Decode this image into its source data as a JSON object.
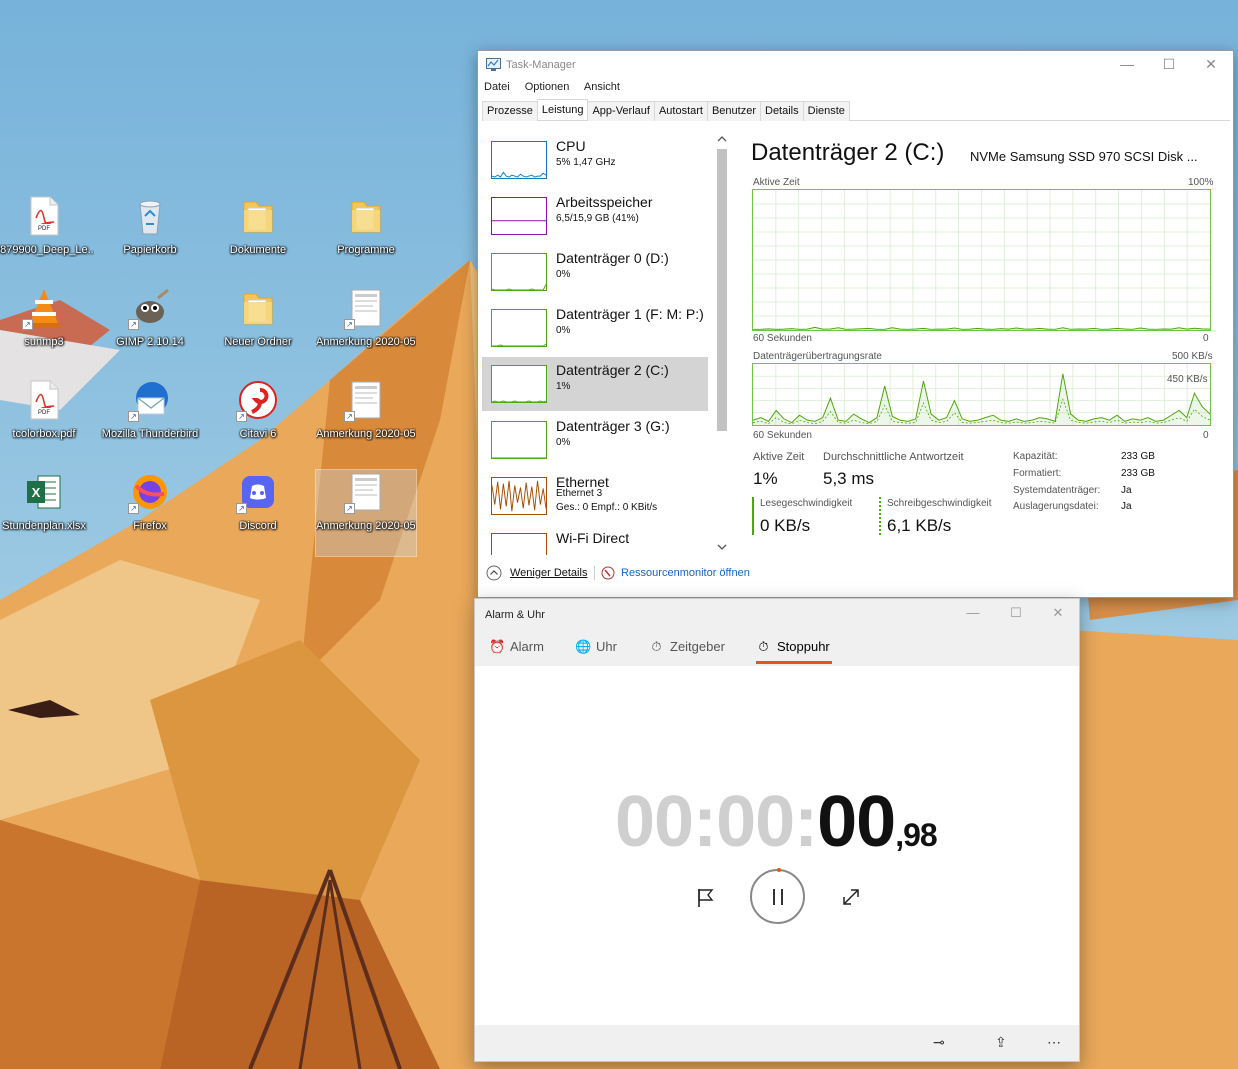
{
  "desktop": {
    "icons": [
      {
        "label": "0879900_Deep_Le...",
        "type": "pdf"
      },
      {
        "label": "Papierkorb",
        "type": "recycle"
      },
      {
        "label": "Dokumente",
        "type": "folder"
      },
      {
        "label": "Programme",
        "type": "folder"
      },
      {
        "label": "sunmp3",
        "type": "vlc"
      },
      {
        "label": "GIMP 2.10.14",
        "type": "gimp"
      },
      {
        "label": "Neuer Ordner",
        "type": "folder"
      },
      {
        "label": "Anmerkung 2020-05-0...",
        "type": "image"
      },
      {
        "label": "tcolorbox.pdf",
        "type": "pdf"
      },
      {
        "label": "Mozilla Thunderbird",
        "type": "thunderbird"
      },
      {
        "label": "Citavi 6",
        "type": "citavi"
      },
      {
        "label": "Anmerkung 2020-05-0...",
        "type": "image"
      },
      {
        "label": "Stundenplan.xlsx",
        "type": "excel"
      },
      {
        "label": "Firefox",
        "type": "firefox"
      },
      {
        "label": "Discord",
        "type": "discord"
      },
      {
        "label": "Anmerkung 2020-05-0...",
        "type": "image"
      }
    ]
  },
  "taskmgr": {
    "title": "Task-Manager",
    "menu": [
      "Datei",
      "Optionen",
      "Ansicht"
    ],
    "tabs": [
      "Prozesse",
      "Leistung",
      "App-Verlauf",
      "Autostart",
      "Benutzer",
      "Details",
      "Dienste"
    ],
    "active_tab": "Leistung",
    "window_buttons": {
      "minimize": "—",
      "maximize": "☐",
      "close": "✕"
    },
    "items": [
      {
        "name": "CPU",
        "sub": "5% 1,47 GHz",
        "color": "#117dbb"
      },
      {
        "name": "Arbeitsspeicher",
        "sub": "6,5/15,9 GB (41%)",
        "color": "#8b12ae"
      },
      {
        "name": "Datenträger 0 (D:)",
        "sub": "0%",
        "color": "#4da60c"
      },
      {
        "name": "Datenträger 1 (F: M: P:)",
        "sub": "0%",
        "color": "#4da60c"
      },
      {
        "name": "Datenträger 2 (C:)",
        "sub": "1%",
        "color": "#4da60c"
      },
      {
        "name": "Datenträger 3 (G:)",
        "sub": "0%",
        "color": "#4da60c"
      },
      {
        "name": "Ethernet",
        "sub": "Ethernet 3",
        "sub2": "Ges.: 0 Empf.: 0 KBit/s",
        "color": "#a74f01"
      },
      {
        "name": "Wi-Fi Direct",
        "sub": "",
        "color": "#a74f01"
      }
    ],
    "detail": {
      "title": "Datenträger 2 (C:)",
      "model": "NVMe Samsung SSD 970 SCSI Disk ...",
      "graph1": {
        "label": "Aktive Zeit",
        "max": "100%",
        "time": "60 Sekunden",
        "min": "0"
      },
      "graph2": {
        "label": "Datenträgerübertragungsrate",
        "max": "500 KB/s",
        "inner": "450 KB/s",
        "time": "60 Sekunden",
        "min": "0"
      },
      "stats": {
        "active_label": "Aktive Zeit",
        "active_value": "1%",
        "resp_label": "Durchschnittliche Antwortzeit",
        "resp_value": "5,3 ms",
        "read_label": "Lesegeschwindigkeit",
        "read_value": "0 KB/s",
        "write_label": "Schreibgeschwindigkeit",
        "write_value": "6,1 KB/s"
      },
      "props": [
        {
          "label": "Kapazität:",
          "value": "233 GB"
        },
        {
          "label": "Formatiert:",
          "value": "233 GB"
        },
        {
          "label": "Systemdatenträger:",
          "value": "Ja"
        },
        {
          "label": "Auslagerungsdatei:",
          "value": "Ja"
        }
      ]
    },
    "footer": {
      "fewer": "Weniger Details",
      "resmon": "Ressourcenmonitor öffnen"
    }
  },
  "alarm": {
    "title": "Alarm & Uhr",
    "tabs": [
      {
        "label": "Alarm",
        "icon": "alarm-clock-icon"
      },
      {
        "label": "Uhr",
        "icon": "world-clock-icon"
      },
      {
        "label": "Zeitgeber",
        "icon": "timer-icon"
      },
      {
        "label": "Stoppuhr",
        "icon": "stopwatch-icon"
      }
    ],
    "active_tab": "Stoppuhr",
    "timer": {
      "dim": "00:00:",
      "bright": "00",
      "cs": ",98"
    },
    "accent": "#e05a10"
  }
}
